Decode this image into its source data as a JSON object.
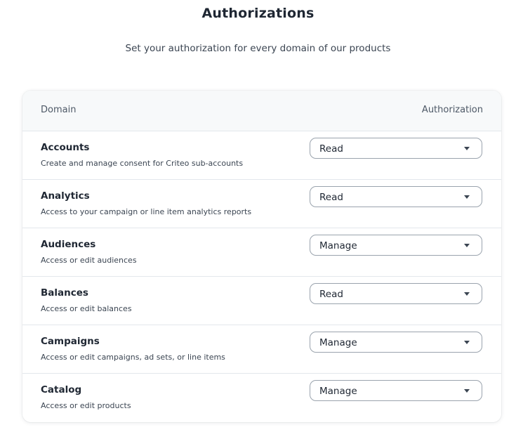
{
  "page": {
    "title": "Authorizations",
    "subtitle": "Set your authorization for every domain of our products"
  },
  "table": {
    "header": {
      "domain_label": "Domain",
      "authorization_label": "Authorization"
    },
    "rows": [
      {
        "name": "Accounts",
        "description": "Create and manage consent for Criteo sub-accounts",
        "authorization": "Read"
      },
      {
        "name": "Analytics",
        "description": "Access to your campaign or line item analytics reports",
        "authorization": "Read"
      },
      {
        "name": "Audiences",
        "description": "Access or edit audiences",
        "authorization": "Manage"
      },
      {
        "name": "Balances",
        "description": "Access or edit balances",
        "authorization": "Read"
      },
      {
        "name": "Campaigns",
        "description": "Access or edit campaigns, ad sets, or line items",
        "authorization": "Manage"
      },
      {
        "name": "Catalog",
        "description": "Access or edit products",
        "authorization": "Manage"
      }
    ]
  },
  "icons": {
    "dropdown": "chevron-down-icon"
  }
}
